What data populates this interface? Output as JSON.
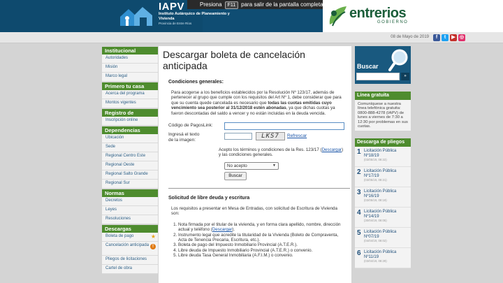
{
  "header": {
    "brand_title": "IAPV",
    "brand_subtitle": "Instituto Autárquico de Planeamiento y Vivienda",
    "brand_province": "Provincia de Entre Ríos",
    "fullscreen_pre": "Presiona",
    "fullscreen_key": "F11",
    "fullscreen_post": "para salir de la pantalla completa",
    "gov_title": "entrerios",
    "gov_sub": "GOBIERNO"
  },
  "datebar": {
    "date": "08 de Mayo de 2019"
  },
  "left_nav": {
    "s0": {
      "title": "Institucional",
      "items": [
        "Autoridades",
        "Misión",
        "Marco legal"
      ]
    },
    "s1": {
      "title": "Primero tu casa",
      "items": [
        "Acerca del programa",
        "Montos vigentes"
      ]
    },
    "s2": {
      "title": "Registro de Demanda",
      "items": [
        "Inscripción online"
      ]
    },
    "s3": {
      "title": "Dependencias",
      "items": [
        "Ubicación",
        "Sede",
        "Regional Centro Este",
        "Regional Oeste",
        "Regional Salto Grande",
        "Regional Sur"
      ]
    },
    "s4": {
      "title": "Normas",
      "items": [
        "Decretos",
        "Leyes",
        "Resoluciones"
      ]
    },
    "s5": {
      "title": "Descargas",
      "items": [
        "Boleta de pago",
        "Cancelación anticipada",
        "Pliegos de licitaciones",
        "Cartel de obra"
      ]
    }
  },
  "main": {
    "title": "Descargar boleta de cancelación anticipada",
    "conditions_heading": "Condiciones generales:",
    "conditions_p1": "Para acogerse a los beneficios establecidos por la Resolución Nº 123/17, además de pertenecer al grupo que cumple con los requisitos del Art Nº 1, debe considerar que para que su cuenta quede cancelada es necesario que",
    "conditions_bold": "todas las cuotas emitidas cuyo vencimiento sea posterior al 31/12/2018 estén abonadas",
    "conditions_p2": ", ya que dichas cuotas ya fueron descontadas del saldo a vencer y no están incluidas en la deuda vencida.",
    "code_label": "Código de PagosLink:",
    "code_value": "",
    "captcha_label_1": "Ingresá el texto",
    "captcha_label_2": "de la imagen:",
    "captcha_value": "",
    "captcha_text": "LKS7",
    "refresh_label": "Refrescar",
    "accept_pre": "Acepto los términos y condiciones de la Res. 123/17",
    "accept_link": "Descargar",
    "accept_post": "y las condiciones generales.",
    "select_value": "No acepto",
    "submit_label": "Buscar",
    "free_debt_heading": "Solicitud de libre deuda y escritura",
    "free_debt_intro": "Los requisitos a presentar en Mesa de Entradas, con solicitud de Escritura de Vivienda son:",
    "req_1": "Nota firmada por el titular de la vivienda, y en forma clara apellido, nombre, dirección actual y teléfono",
    "req_1_link": "Descargar",
    "req_2": "Instrumento legal que acredite la titularidad de la Vivienda (Boleto de Compraventa, Acta de Tenencia Precaria, Escritura, etc.).",
    "req_3": "Boleta de pago del Impuesto Inmobiliario Provincial (A.T.E.R.).",
    "req_4": "Libre deuda de Impuesto Inmobiliario Provincial (A.T.E.R.) o convenio.",
    "req_5": "Libre deuda Tasa General Inmobiliaria (A.F.I.M.) o convenio."
  },
  "right": {
    "search_label": "Buscar",
    "search_placeholder": "",
    "hotline_title": "Línea gratuita",
    "hotline_text": "Comuníquese a nuestra línea telefónica gratuita: 0800-888-4278 (IAPV) de lunes a viernes de 7:30 a 12:30 por problemas en sus cuotas.",
    "pliegos_title": "Descarga de pliegos",
    "pliegos": [
      {
        "n": "1",
        "title": "Licitación Pública Nº18/19",
        "date": "(03/05/19, 08:22)"
      },
      {
        "n": "2",
        "title": "Licitación Pública Nº17/19",
        "date": "(03/05/19, 08:21)"
      },
      {
        "n": "3",
        "title": "Licitación Pública Nº16/19",
        "date": "(03/05/19, 08:19)"
      },
      {
        "n": "4",
        "title": "Licitación Pública Nº14/19",
        "date": "(30/04/19, 08:05)"
      },
      {
        "n": "5",
        "title": "Licitación Pública Nº07/19",
        "date": "(04/04/19, 08:02)"
      },
      {
        "n": "6",
        "title": "Licitación Pública Nº11/19",
        "date": "(03/04/19, 08:29)"
      }
    ]
  },
  "colors": {
    "header_blue": "#0f4d73",
    "nav_green": "#4e8c2e",
    "link_blue": "#1a55a8",
    "search_blue": "#19597f"
  }
}
